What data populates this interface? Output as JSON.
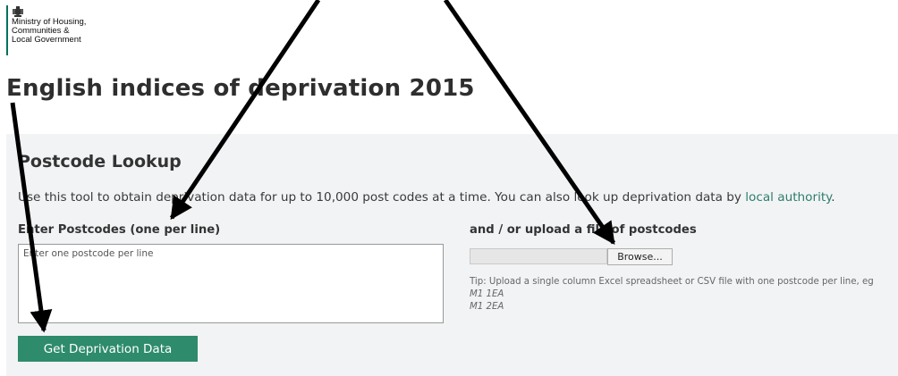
{
  "header": {
    "org_lines": [
      "Ministry of Housing,",
      "Communities &",
      "Local Government"
    ]
  },
  "page_title": "English indices of deprivation 2015",
  "lookup": {
    "heading": "Postcode Lookup",
    "intro_text": "Use this tool to obtain deprivation data for up to 10,000 post codes at a time. You can also look up deprivation data by ",
    "intro_link": "local authority",
    "intro_end": ".",
    "postcodes_label": "Enter Postcodes (one per line)",
    "postcodes_placeholder": "Enter one postcode per line",
    "upload_label": "and / or upload a file of postcodes",
    "browse_label": "Browse...",
    "tip_text": "Tip: Upload a single column Excel spreadsheet or CSV file with one postcode per line, eg",
    "tip_examples": [
      "M1 1EA",
      "M1 2EA"
    ],
    "submit_label": "Get Deprivation Data"
  },
  "colors": {
    "brand_green": "#00705c",
    "button_green": "#2e8b6b",
    "link_green": "#2e7d6b",
    "panel_bg": "#f1f3f5"
  },
  "icons": [
    "royal-crest-icon",
    "annotation-arrow-icon"
  ]
}
